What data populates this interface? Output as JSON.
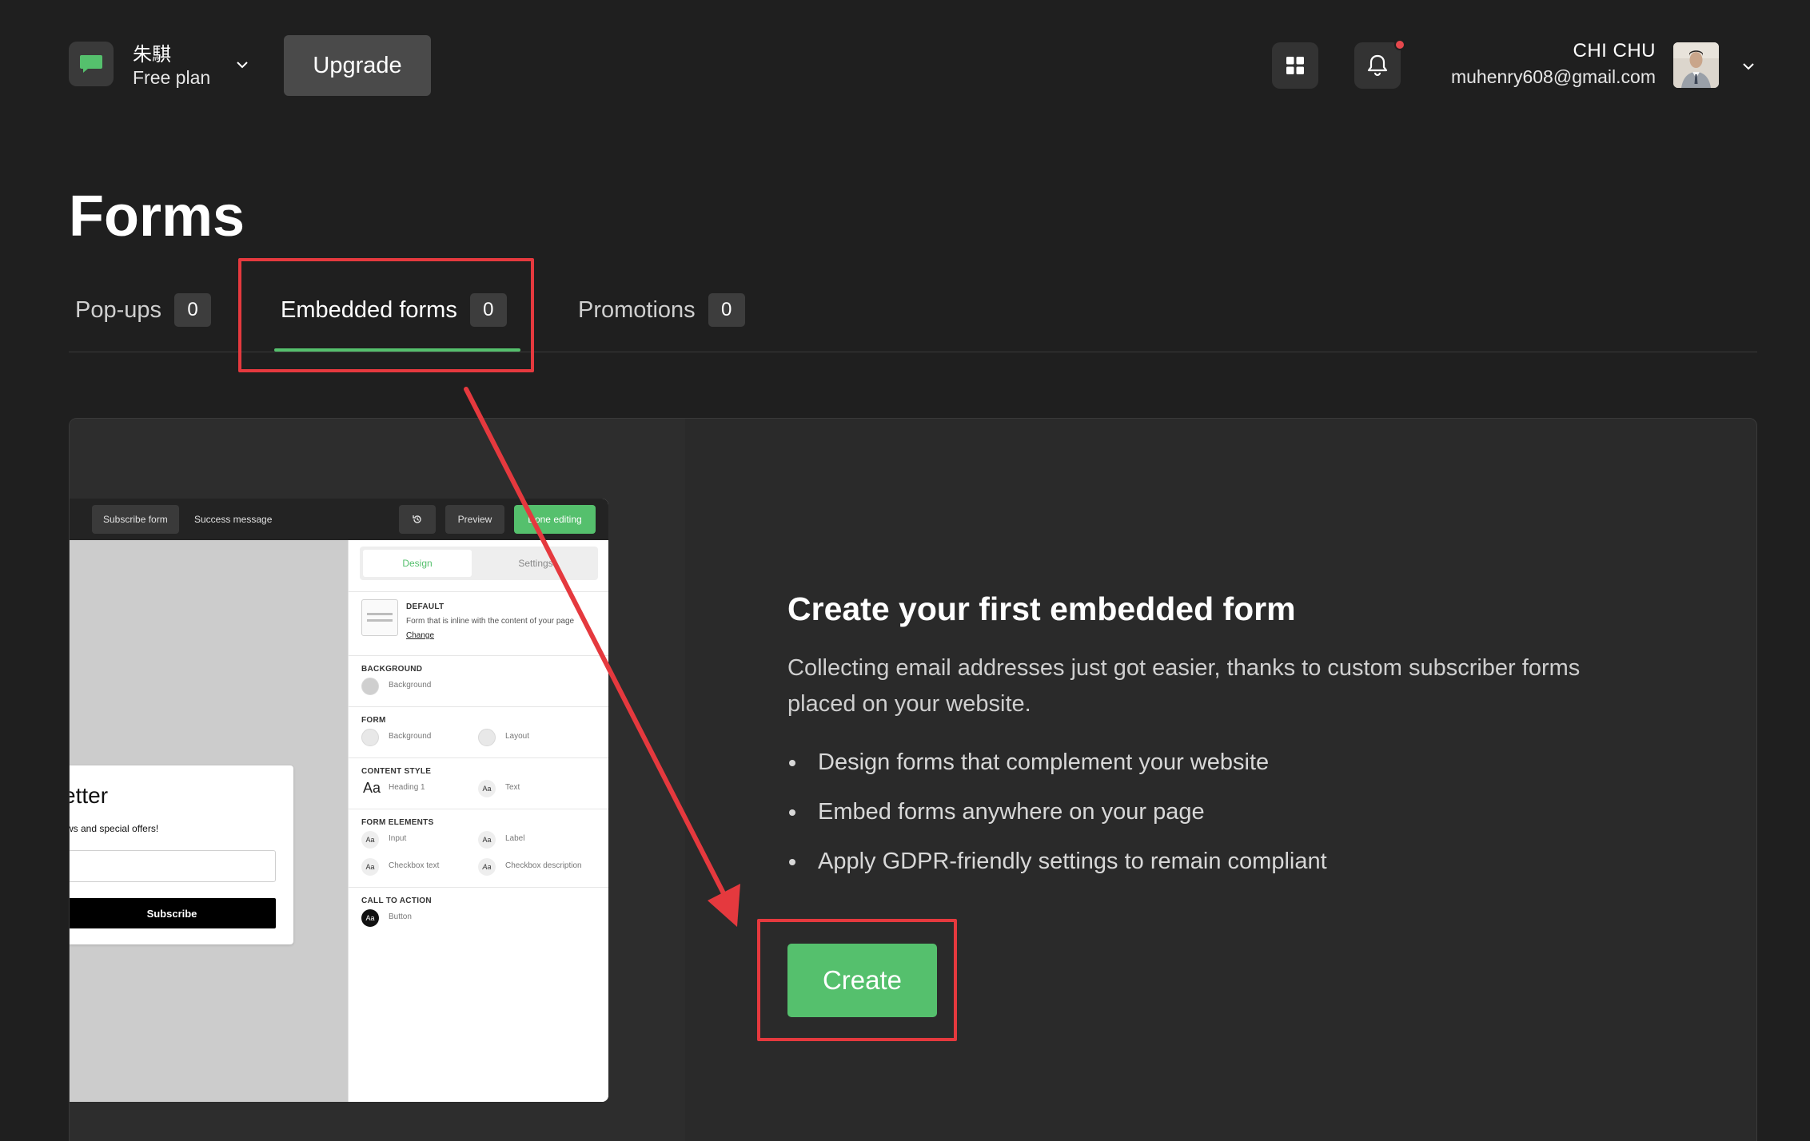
{
  "topbar": {
    "brand_name": "朱騏",
    "brand_plan": "Free plan",
    "upgrade_label": "Upgrade",
    "user_name": "CHI CHU",
    "user_email": "muhenry608@gmail.com",
    "icons": [
      "chat-bubble-icon",
      "chevron-down-icon",
      "apps-grid-icon",
      "bell-icon",
      "avatar",
      "chevron-down-icon"
    ]
  },
  "page": {
    "title": "Forms",
    "tabs": [
      {
        "label": "Pop-ups",
        "count": "0"
      },
      {
        "label": "Embedded forms",
        "count": "0",
        "active": true
      },
      {
        "label": "Promotions",
        "count": "0"
      }
    ]
  },
  "preview": {
    "toolbar": {
      "subscribe_form": "Subscribe form",
      "success_message": "Success message",
      "preview": "Preview",
      "done_editing": "Done editing"
    },
    "form": {
      "title": "etter",
      "subtitle": "ws and special offers!",
      "button": "Subscribe"
    },
    "panel": {
      "tab_design": "Design",
      "tab_settings": "Settings",
      "default_head": "DEFAULT",
      "default_desc": "Form that is inline with the content of your page",
      "change": "Change",
      "background_head": "BACKGROUND",
      "background_label": "Background",
      "form_head": "FORM",
      "form_background": "Background",
      "form_layout": "Layout",
      "content_style_head": "CONTENT STYLE",
      "heading1": "Heading 1",
      "text": "Text",
      "form_elements_head": "FORM ELEMENTS",
      "input": "Input",
      "label": "Label",
      "checkbox_text": "Checkbox text",
      "checkbox_description": "Checkbox description",
      "cta_head": "CALL TO ACTION",
      "button": "Button"
    }
  },
  "cta": {
    "heading": "Create your first embedded form",
    "description": "Collecting email addresses just got easier, thanks to custom subscriber forms placed on your website.",
    "bullets": [
      "Design forms that complement your website",
      "Embed forms anywhere on your page",
      "Apply GDPR-friendly settings to remain compliant"
    ],
    "create_label": "Create"
  },
  "colors": {
    "background": "#1f1f1f",
    "accent_green": "#55c06d",
    "annotation_red": "#e5393e",
    "notification_dot": "#e5484d"
  }
}
